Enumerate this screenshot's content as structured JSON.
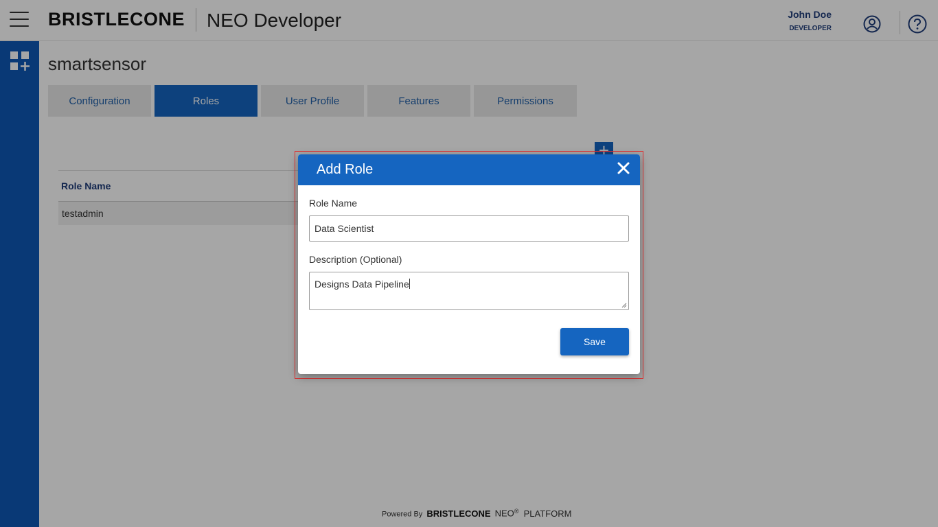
{
  "header": {
    "brand": "BRISTLECONE",
    "app_title": "NEO Developer",
    "user_name": "John Doe",
    "user_role": "DEVELOPER"
  },
  "page": {
    "title": "smartsensor",
    "tabs": [
      {
        "label": "Configuration",
        "active": false
      },
      {
        "label": "Roles",
        "active": true
      },
      {
        "label": "User Profile",
        "active": false
      },
      {
        "label": "Features",
        "active": false
      },
      {
        "label": "Permissions",
        "active": false
      }
    ],
    "add_button": "+"
  },
  "table": {
    "columns": [
      "Role Name"
    ],
    "rows": [
      [
        "testadmin"
      ]
    ]
  },
  "footer": {
    "powered_by": "Powered By",
    "brand": "BRISTLECONE",
    "neo": "NEO",
    "registered": "®",
    "platform": "PLATFORM"
  },
  "modal": {
    "title": "Add Role",
    "role_name_label": "Role Name",
    "role_name_value": "Data Scientist",
    "description_label": "Description (Optional)",
    "description_value": "Designs Data Pipeline",
    "save_label": "Save"
  },
  "colors": {
    "primary": "#1565c0",
    "sidebar": "#0f58b5",
    "highlight": "#e03030"
  },
  "icons": [
    "hamburger-icon",
    "user-circle-icon",
    "help-icon",
    "apps-add-icon",
    "close-icon",
    "plus-icon"
  ]
}
